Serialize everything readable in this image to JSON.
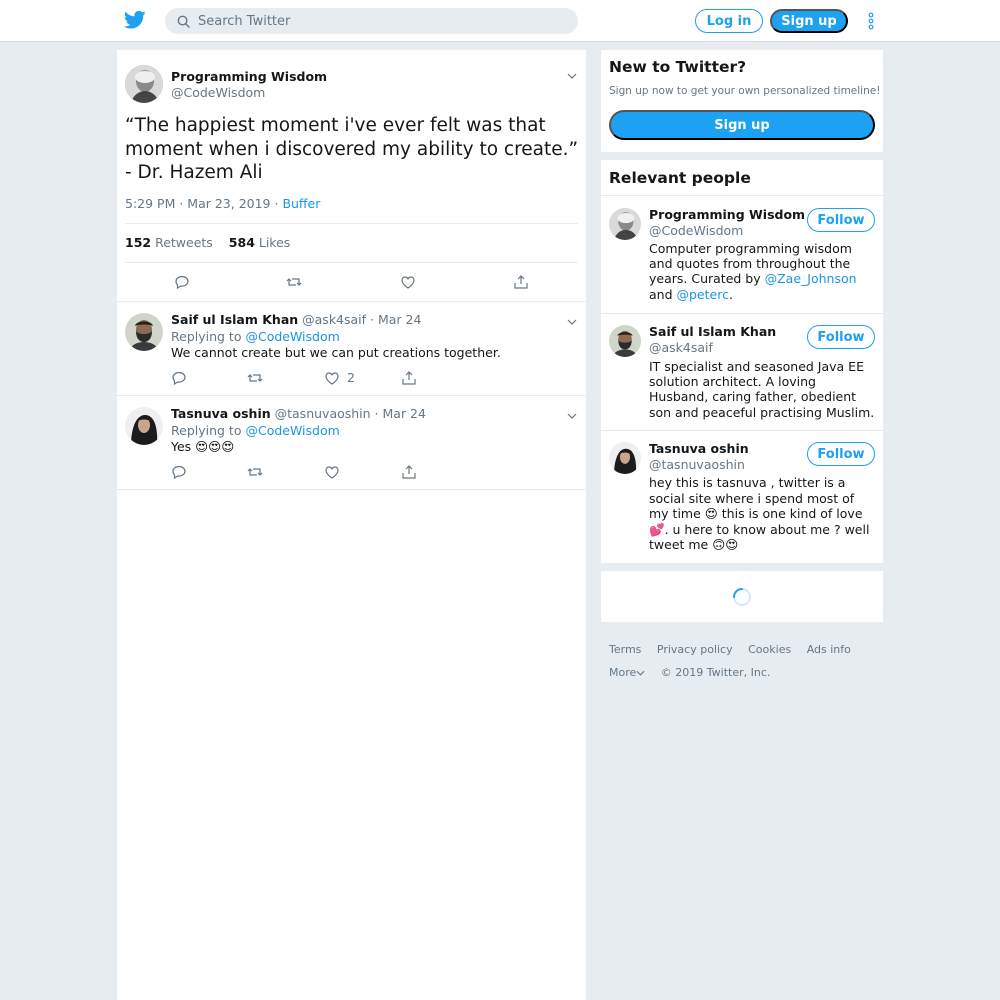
{
  "topbar": {
    "search_placeholder": "Search Twitter",
    "login_label": "Log in",
    "signup_label": "Sign up"
  },
  "tweet": {
    "author_name": "Programming Wisdom",
    "author_handle": "@CodeWisdom",
    "text": "“The happiest moment i've ever felt was that moment when i discovered my ability to create.” - Dr. Hazem Ali",
    "time": "5:29 PM · Mar 23, 2019 · ",
    "source": "Buffer",
    "retweets_count": "152",
    "retweets_label": "Retweets",
    "likes_count": "584",
    "likes_label": "Likes"
  },
  "replies": [
    {
      "name": "Saif ul Islam Khan",
      "handle_date": "@ask4saif · Mar 24",
      "replying_label": "Replying to",
      "replying_to": "@CodeWisdom",
      "text": "We cannot create but we can put creations together.",
      "likes": "2"
    },
    {
      "name": "Tasnuva oshin",
      "handle_date": "@tasnuvaoshin · Mar 24",
      "replying_label": "Replying to",
      "replying_to": "@CodeWisdom",
      "text": "Yes 😍😍😍",
      "likes": ""
    }
  ],
  "sidebar": {
    "new_title": "New to Twitter?",
    "new_subtitle": "Sign up now to get your own personalized timeline!",
    "new_signup": "Sign up",
    "relevant_title": "Relevant people",
    "follow_label": "Follow",
    "people": [
      {
        "name": "Programming Wisdom",
        "handle": "@CodeWisdom",
        "bio_pre": "Computer programming wisdom and quotes from throughout the years. Curated by ",
        "bio_link1": "@Zae_Johnson",
        "bio_mid": " and ",
        "bio_link2": "@peterc",
        "bio_post": "."
      },
      {
        "name": "Saif ul Islam Khan",
        "handle": "@ask4saif",
        "bio": "IT specialist and seasoned Java EE solution architect. A loving Husband, caring father, obedient son and peaceful practising Muslim."
      },
      {
        "name": "Tasnuva oshin",
        "handle": "@tasnuvaoshin",
        "bio": "hey this is tasnuva , twitter is a social site where i spend most of my time 😍 this is one kind of love 💕. u here to know about me ? well tweet me 🙃😍"
      }
    ]
  },
  "footer": {
    "terms": "Terms",
    "privacy": "Privacy policy",
    "cookies": "Cookies",
    "ads": "Ads info",
    "more": "More",
    "copyright": "© 2019 Twitter, Inc."
  },
  "colors": {
    "accent": "#1da1f2",
    "link": "#1b95e0",
    "background": "#e6ecf0",
    "muted": "#657786"
  }
}
